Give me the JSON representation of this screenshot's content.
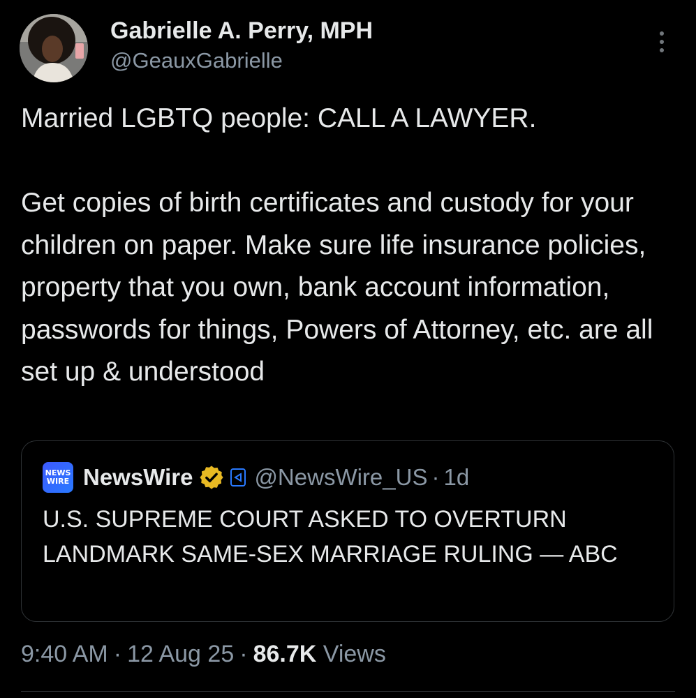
{
  "author": {
    "display_name": "Gabrielle A. Perry, MPH",
    "handle": "@GeauxGabrielle",
    "avatar_icon": "profile-photo"
  },
  "tweet": {
    "text": "Married LGBTQ people: CALL A LAWYER.\n\nGet copies of birth certificates and custody for your children on paper. Make sure life insurance policies, property that you own, bank account information, passwords for things, Powers of Attorney, etc. are all set up & understood"
  },
  "quote": {
    "logo_text": [
      "NEWS",
      "WIRE"
    ],
    "name": "NewsWire",
    "badge_icon": "gold-verified-badge",
    "affiliate_icon": "affiliate-badge",
    "handle": "@NewsWire_US",
    "separator": "·",
    "time": "1d",
    "text": "U.S. SUPREME COURT ASKED TO OVERTURN LANDMARK SAME-SEX MARRIAGE RULING — ABC"
  },
  "meta": {
    "time": "9:40 AM",
    "date": "12 Aug 25",
    "separator": "·",
    "views_count": "86.7K",
    "views_label": "Views"
  },
  "colors": {
    "background": "#000000",
    "text_primary": "#e7e9ea",
    "text_secondary": "#8b98a5",
    "border": "#2f3336",
    "gold_badge": "#e8b923",
    "brand_blue": "#2979ff"
  }
}
